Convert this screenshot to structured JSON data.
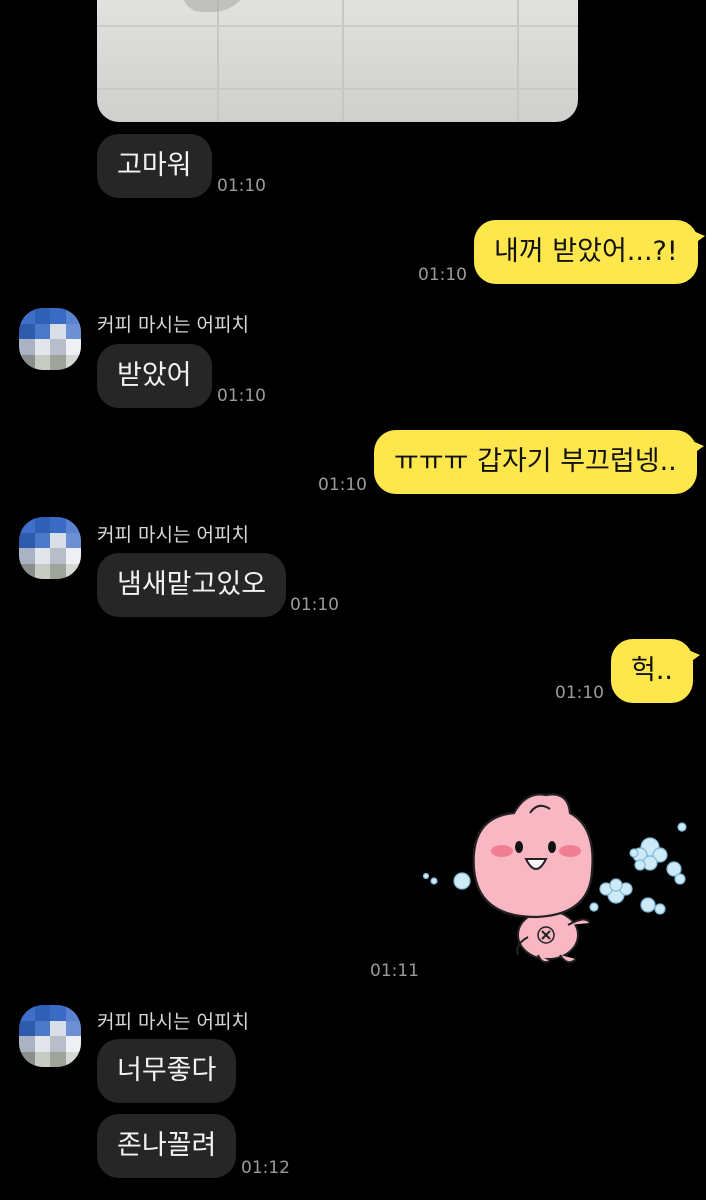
{
  "messages": {
    "m1": {
      "text": "고마워",
      "time": "01:10"
    },
    "m2": {
      "text": "내꺼 받았어...?!",
      "time": "01:10"
    },
    "m3": {
      "sender": "커피 마시는 어피치",
      "text": "받았어",
      "time": "01:10"
    },
    "m4": {
      "text": "ㅠㅠㅠ 갑자기 부끄럽넹..",
      "time": "01:10"
    },
    "m5": {
      "sender": "커피 마시는 어피치",
      "text": "냄새맡고있오",
      "time": "01:10"
    },
    "m6": {
      "text": "헉..",
      "time": "01:10"
    },
    "m7": {
      "sticker": "apeach-sticker",
      "time": "01:11"
    },
    "m8": {
      "sender": "커피 마시는 어피치",
      "text": "너무좋다"
    },
    "m9": {
      "text": "존나꼴려",
      "time": "01:12"
    }
  },
  "colors": {
    "background": "#000000",
    "incoming_bubble": "#262626",
    "outgoing_bubble": "#fde74c",
    "time_text": "#9b9b9b"
  }
}
